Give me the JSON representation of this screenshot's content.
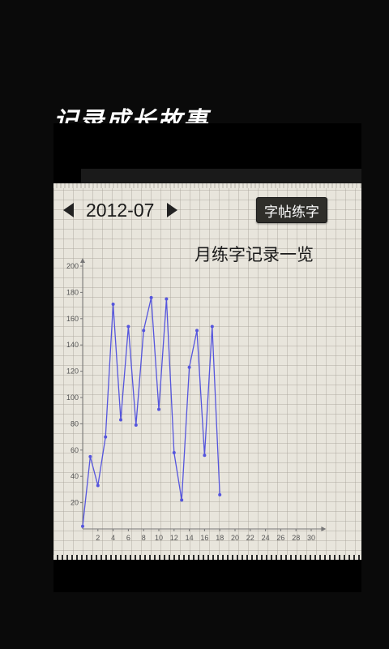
{
  "header": {
    "slogan": "记录成长故事……"
  },
  "nav": {
    "prev_icon": "caret-left-icon",
    "month": "2012-07",
    "next_icon": "caret-right-icon",
    "copybook_button": "字帖练字"
  },
  "chart_data": {
    "type": "line",
    "title": "月练字记录一览",
    "xlim": [
      0,
      31
    ],
    "ylim": [
      0,
      200
    ],
    "x_ticks": [
      2,
      4,
      6,
      8,
      10,
      12,
      14,
      16,
      18,
      20,
      22,
      24,
      26,
      28,
      30
    ],
    "y_ticks": [
      20,
      40,
      60,
      80,
      100,
      120,
      140,
      160,
      180,
      200
    ],
    "series": [
      {
        "color": "#5555dd",
        "points": [
          [
            0,
            2
          ],
          [
            1,
            55
          ],
          [
            2,
            33
          ],
          [
            3,
            70
          ],
          [
            4,
            171
          ],
          [
            5,
            83
          ],
          [
            6,
            154
          ],
          [
            7,
            79
          ],
          [
            8,
            151
          ],
          [
            9,
            176
          ],
          [
            10,
            91
          ],
          [
            11,
            175
          ],
          [
            12,
            58
          ],
          [
            13,
            22
          ],
          [
            14,
            123
          ],
          [
            15,
            151
          ],
          [
            16,
            56
          ],
          [
            17,
            154
          ],
          [
            18,
            26
          ]
        ]
      }
    ]
  }
}
